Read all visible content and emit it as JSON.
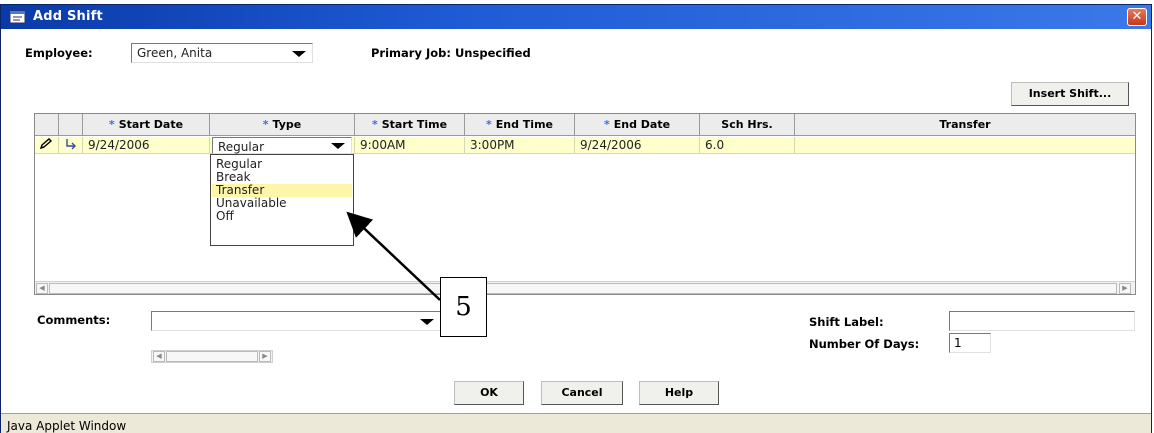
{
  "window": {
    "title": "Add Shift",
    "close_symbol": "✕",
    "status_text": "Java Applet Window"
  },
  "form": {
    "employee_label": "Employee:",
    "employee_value": "Green, Anita",
    "primary_job_text": "Primary Job: Unspecified",
    "insert_shift_label": "Insert Shift..."
  },
  "grid": {
    "columns": [
      "* Start Date",
      "* Type",
      "* Start Time",
      "* End Time",
      "* End Date",
      "Sch Hrs.",
      "Transfer"
    ],
    "column_stars": [
      "*",
      "*",
      "*",
      "*",
      "*",
      "",
      ""
    ],
    "column_names": [
      "Start Date",
      "Type",
      "Start Time",
      "End Time",
      "End Date",
      "Sch Hrs.",
      "Transfer"
    ],
    "row": {
      "edit_icon": "pencil-icon",
      "pointer_icon": "row-pointer-icon",
      "start_date": "9/24/2006",
      "type": "Regular",
      "start_time": "9:00AM",
      "end_time": "3:00PM",
      "end_date": "9/24/2006",
      "sch_hrs": "6.0",
      "transfer": ""
    },
    "type_options": [
      "Regular",
      "Break",
      "Transfer",
      "Unavailable",
      "Off"
    ],
    "type_highlighted": "Transfer"
  },
  "bottom": {
    "comments_label": "Comments:",
    "comments_value": "",
    "shift_label_label": "Shift Label:",
    "shift_label_value": "",
    "number_of_days_label": "Number Of Days:",
    "number_of_days_value": "1"
  },
  "buttons": {
    "ok": "OK",
    "cancel": "Cancel",
    "help": "Help"
  },
  "annotation": {
    "callout_number": "5"
  },
  "colors": {
    "titlebar": "#1f5bd6",
    "selected_row": "#ffffcc",
    "highlight_option": "#fdf5a8",
    "required_star": "#3a6fd8"
  }
}
